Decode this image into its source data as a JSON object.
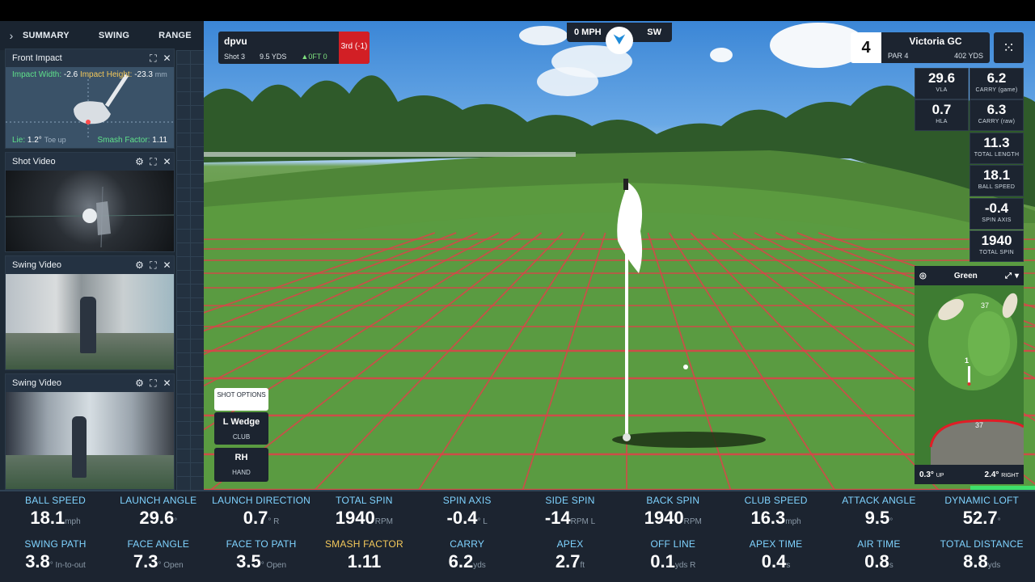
{
  "sidebar": {
    "tabs": [
      "SUMMARY",
      "SWING",
      "RANGE"
    ],
    "panels": {
      "front_impact": {
        "title": "Front Impact",
        "impact_width_label": "Impact Width:",
        "impact_width_value": "-2.6",
        "impact_height_label": "Impact Height:",
        "impact_height_value": "-23.3",
        "unit": "mm",
        "lie_label": "Lie:",
        "lie_value": "1.2°",
        "lie_note": "Toe up",
        "smash_label": "Smash Factor:",
        "smash_value": "1.11"
      },
      "shot_video": {
        "title": "Shot Video"
      },
      "swing_video_1": {
        "title": "Swing Video"
      },
      "swing_video_2": {
        "title": "Swing Video"
      }
    }
  },
  "player": {
    "name": "dpvu",
    "shot": "Shot 3",
    "distance": "9.5 YDS",
    "offset": "0FT 0",
    "rank": "3rd (-1)"
  },
  "wind": {
    "speed": "0 MPH",
    "direction": "SW"
  },
  "hole": {
    "number": "4",
    "course": "Victoria GC",
    "par": "PAR 4",
    "yards": "402 YDS"
  },
  "stat_tiles": [
    {
      "value": "29.6",
      "label": "VLA"
    },
    {
      "value": "6.2",
      "label": "CARRY (game)"
    },
    {
      "value": "0.7",
      "label": "HLA"
    },
    {
      "value": "6.3",
      "label": "CARRY (raw)"
    },
    {
      "value": "11.3",
      "label": "TOTAL LENGTH"
    },
    {
      "value": "18.1",
      "label": "BALL SPEED"
    },
    {
      "value": "-0.4",
      "label": "SPIN AXIS"
    },
    {
      "value": "1940",
      "label": "TOTAL SPIN"
    }
  ],
  "minimap": {
    "title": "Green",
    "marker_top": "37",
    "marker_bottom": "37",
    "pin": "1",
    "elevation_value": "0.3°",
    "elevation_label": "UP",
    "side_value": "2.4°",
    "side_label": "RIGHT",
    "progress_fraction": 1.0
  },
  "shot_options": {
    "button": "SHOT OPTIONS",
    "club_value": "L Wedge",
    "club_label": "CLUB",
    "hand_value": "RH",
    "hand_label": "HAND"
  },
  "data_row_1": [
    {
      "label": "BALL SPEED",
      "value": "18.1",
      "unit": "mph"
    },
    {
      "label": "LAUNCH ANGLE",
      "value": "29.6",
      "unit": "°"
    },
    {
      "label": "LAUNCH DIRECTION",
      "value": "0.7",
      "unit": "° R"
    },
    {
      "label": "TOTAL SPIN",
      "value": "1940",
      "unit": "RPM"
    },
    {
      "label": "SPIN AXIS",
      "value": "-0.4",
      "unit": "° L"
    },
    {
      "label": "SIDE SPIN",
      "value": "-14",
      "unit": "RPM L"
    },
    {
      "label": "BACK SPIN",
      "value": "1940",
      "unit": "RPM"
    },
    {
      "label": "CLUB SPEED",
      "value": "16.3",
      "unit": "mph"
    },
    {
      "label": "ATTACK ANGLE",
      "value": "9.5",
      "unit": "°"
    },
    {
      "label": "DYNAMIC LOFT",
      "value": "52.7",
      "unit": "°"
    }
  ],
  "data_row_2": [
    {
      "label": "SWING PATH",
      "value": "3.8",
      "unit": "° In-to-out"
    },
    {
      "label": "FACE ANGLE",
      "value": "7.3",
      "unit": "° Open"
    },
    {
      "label": "FACE TO PATH",
      "value": "3.5",
      "unit": "° Open"
    },
    {
      "label": "SMASH FACTOR",
      "value": "1.11",
      "unit": ""
    },
    {
      "label": "CARRY",
      "value": "6.2",
      "unit": "yds"
    },
    {
      "label": "APEX",
      "value": "2.7",
      "unit": "ft"
    },
    {
      "label": "OFF LINE",
      "value": "0.1",
      "unit": "yds R"
    },
    {
      "label": "APEX TIME",
      "value": "0.4",
      "unit": "s"
    },
    {
      "label": "AIR TIME",
      "value": "0.8",
      "unit": "s"
    },
    {
      "label": "TOTAL DISTANCE",
      "value": "8.8",
      "unit": "yds"
    }
  ],
  "colors": {
    "accent_blue": "#7fd3ff",
    "accent_gold": "#f3c85a",
    "rank_red": "#d21f25",
    "panel_bg": "#1c2430",
    "grid_red": "#e0404a"
  }
}
